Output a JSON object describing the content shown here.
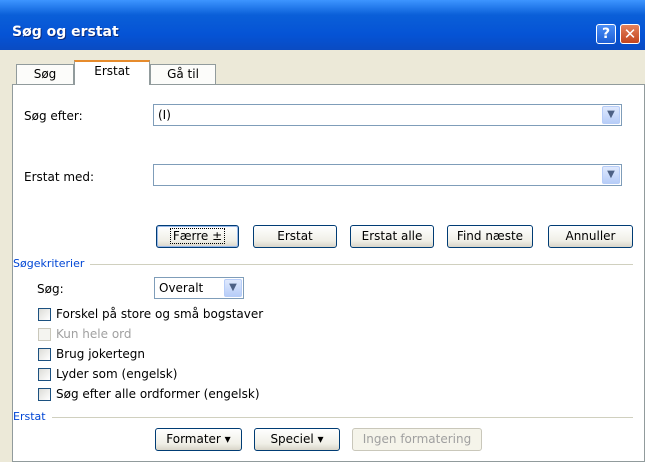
{
  "window": {
    "title": "Søg og erstat",
    "help_glyph": "?",
    "close_glyph": "✕"
  },
  "tabs": [
    "Søg",
    "Erstat",
    "Gå til"
  ],
  "find": {
    "label": "Søg efter:",
    "value": "(I)"
  },
  "replace": {
    "label": "Erstat med:",
    "value": ""
  },
  "buttons": {
    "less": "Færre ±",
    "replace": "Erstat",
    "replace_all": "Erstat alle",
    "find_next": "Find næste",
    "cancel": "Annuller"
  },
  "criteria": {
    "section_title": "Søgekriterier",
    "search_label": "Søg:",
    "search_value": "Overalt",
    "options": [
      {
        "label": "Forskel på store og små bogstaver",
        "checked": false,
        "enabled": true
      },
      {
        "label": "Kun hele ord",
        "checked": false,
        "enabled": false
      },
      {
        "label": "Brug jokertegn",
        "checked": false,
        "enabled": true
      },
      {
        "label": "Lyder som (engelsk)",
        "checked": false,
        "enabled": true
      },
      {
        "label": "Søg efter alle ordformer (engelsk)",
        "checked": false,
        "enabled": true
      }
    ]
  },
  "replace_section": {
    "title": "Erstat",
    "format": "Formater ▾",
    "special": "Speciel ▾",
    "no_format": "Ingen formatering"
  },
  "colors": {
    "titlebar": "#0553d5",
    "section_title": "#0046d5",
    "tab_accent": "#e68b2c"
  }
}
